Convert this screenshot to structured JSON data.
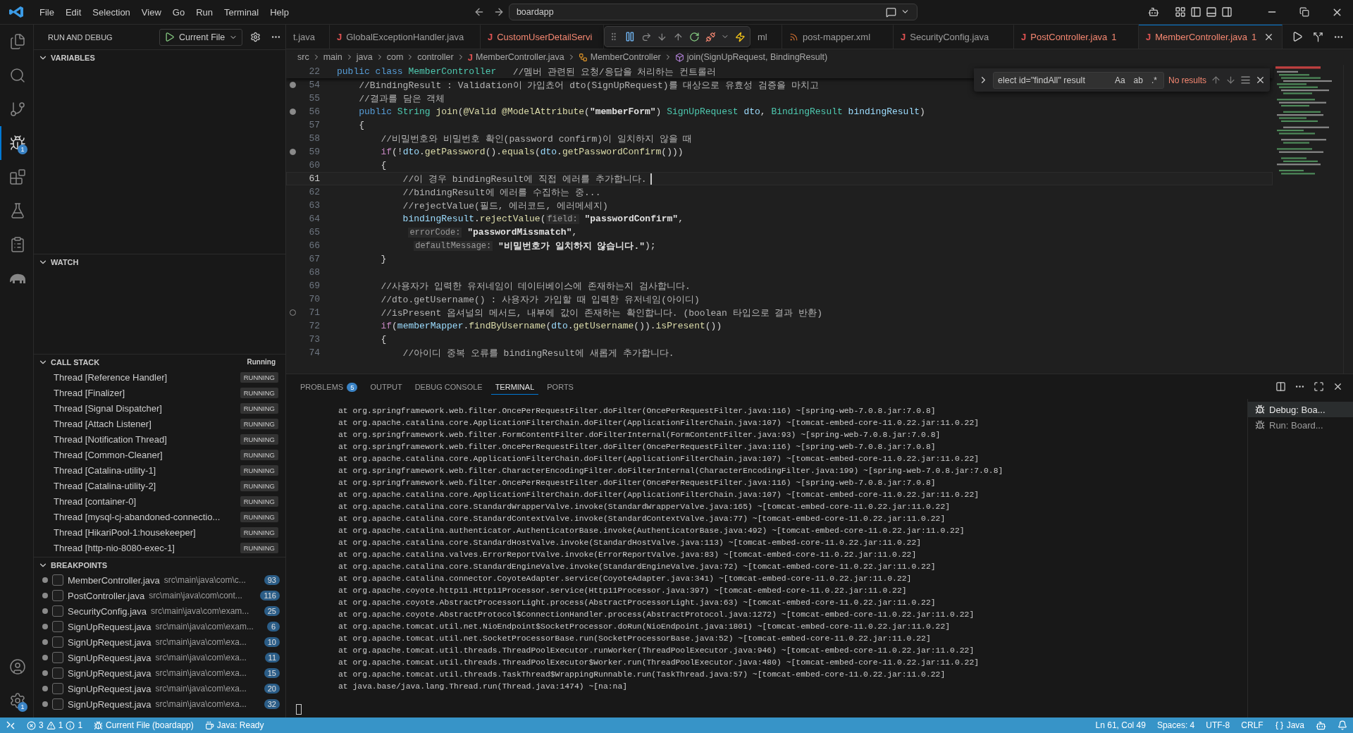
{
  "title_bar": {
    "menu": [
      "File",
      "Edit",
      "Selection",
      "View",
      "Go",
      "Run",
      "Terminal",
      "Help"
    ],
    "search": "boardapp"
  },
  "activity_bar": {
    "items": [
      {
        "kind": "files",
        "selected": false
      },
      {
        "kind": "search",
        "selected": false
      },
      {
        "kind": "source-control",
        "selected": false
      },
      {
        "kind": "debug",
        "selected": true,
        "badge": "1"
      },
      {
        "kind": "extensions",
        "selected": false
      },
      {
        "kind": "testing",
        "selected": false
      },
      {
        "kind": "clipboard",
        "selected": false
      },
      {
        "kind": "elephant",
        "selected": false
      }
    ],
    "bottom": [
      {
        "kind": "account"
      },
      {
        "kind": "settings",
        "badge": "1"
      }
    ]
  },
  "sidebar": {
    "title": "RUN AND DEBUG",
    "config": "Current File",
    "variables": {
      "title": "VARIABLES",
      "expanded": true
    },
    "watch": {
      "title": "WATCH",
      "expanded": true
    },
    "call_stack": {
      "title": "CALL STACK",
      "expanded": true,
      "status": "Running",
      "threads": [
        {
          "name": "Thread [Reference Handler]",
          "state": "RUNNING"
        },
        {
          "name": "Thread [Finalizer]",
          "state": "RUNNING"
        },
        {
          "name": "Thread [Signal Dispatcher]",
          "state": "RUNNING"
        },
        {
          "name": "Thread [Attach Listener]",
          "state": "RUNNING"
        },
        {
          "name": "Thread [Notification Thread]",
          "state": "RUNNING"
        },
        {
          "name": "Thread [Common-Cleaner]",
          "state": "RUNNING"
        },
        {
          "name": "Thread [Catalina-utility-1]",
          "state": "RUNNING"
        },
        {
          "name": "Thread [Catalina-utility-2]",
          "state": "RUNNING"
        },
        {
          "name": "Thread [container-0]",
          "state": "RUNNING"
        },
        {
          "name": "Thread [mysql-cj-abandoned-connectio...",
          "state": "RUNNING"
        },
        {
          "name": "Thread [HikariPool-1:housekeeper]",
          "state": "RUNNING"
        },
        {
          "name": "Thread [http-nio-8080-exec-1]",
          "state": "RUNNING"
        }
      ]
    },
    "breakpoints": {
      "title": "BREAKPOINTS",
      "expanded": true,
      "items": [
        {
          "file": "MemberController.java",
          "path": "src\\main\\java\\com\\c...",
          "line": "93",
          "checked": false
        },
        {
          "file": "PostController.java",
          "path": "src\\main\\java\\com\\cont...",
          "line": "116",
          "checked": false
        },
        {
          "file": "SecurityConfig.java",
          "path": "src\\main\\java\\com\\exam...",
          "line": "25",
          "checked": false
        },
        {
          "file": "SignUpRequest.java",
          "path": "src\\main\\java\\com\\exam...",
          "line": "6",
          "checked": false
        },
        {
          "file": "SignUpRequest.java",
          "path": "src\\main\\java\\com\\exa...",
          "line": "10",
          "checked": false
        },
        {
          "file": "SignUpRequest.java",
          "path": "src\\main\\java\\com\\exa...",
          "line": "11",
          "checked": false
        },
        {
          "file": "SignUpRequest.java",
          "path": "src\\main\\java\\com\\exa...",
          "line": "15",
          "checked": false
        },
        {
          "file": "SignUpRequest.java",
          "path": "src\\main\\java\\com\\exa...",
          "line": "20",
          "checked": false
        },
        {
          "file": "SignUpRequest.java",
          "path": "src\\main\\java\\com\\exa...",
          "line": "32",
          "checked": false
        }
      ]
    }
  },
  "editor": {
    "tabs": [
      {
        "label": "t.java",
        "kind": "none",
        "error": false,
        "selected": false
      },
      {
        "label": "GlobalExceptionHandler.java",
        "kind": "java",
        "icon": "J",
        "error": false,
        "selected": false
      },
      {
        "label": "CustomUserDetailServi",
        "kind": "java",
        "icon": "J",
        "error": true,
        "selected": false
      },
      {
        "label": "ml",
        "kind": "none",
        "error": false,
        "selected": false
      },
      {
        "label": "post-mapper.xml",
        "kind": "xml",
        "error": false,
        "selected": false
      },
      {
        "label": "SecurityConfig.java",
        "kind": "java",
        "icon": "J",
        "error": false,
        "selected": false
      },
      {
        "label": "PostController.java",
        "kind": "java",
        "icon": "J",
        "error": true,
        "count": "1",
        "selected": false
      },
      {
        "label": "MemberController.java",
        "kind": "java",
        "icon": "J",
        "error": true,
        "count": "1",
        "selected": true
      }
    ],
    "breadcrumb": [
      {
        "text": "src",
        "kind": "folder"
      },
      {
        "text": "main",
        "kind": "folder"
      },
      {
        "text": "java",
        "kind": "folder"
      },
      {
        "text": "com",
        "kind": "folder"
      },
      {
        "text": "controller",
        "kind": "folder"
      },
      {
        "text": "MemberController.java",
        "kind": "java",
        "icon": "J"
      },
      {
        "text": "MemberController",
        "kind": "class"
      },
      {
        "text": "join(SignUpRequest, BindingResult)",
        "kind": "method"
      }
    ],
    "sticky": {
      "number": "22",
      "tokens": [
        {
          "t": "public class ",
          "kind": "kw"
        },
        {
          "t": "MemberController",
          "kind": "type"
        },
        {
          "t": "   //멤버 관련된 요청/응답을 처리하는 컨트롤러",
          "kind": "cmt"
        }
      ]
    },
    "lines": [
      {
        "number": "54",
        "kind": "breakpoint",
        "current": false,
        "tokens": [
          {
            "t": "    //BindingResult : Validation이 가입쵸어 dto(SignUpRequest)를 대상으로 유효성 검증을 마치고",
            "kind": "cmt"
          }
        ]
      },
      {
        "number": "55",
        "kind": "plain",
        "current": false,
        "tokens": [
          {
            "t": "    //결과를 담은 객체",
            "kind": "cmt"
          }
        ]
      },
      {
        "number": "56",
        "kind": "breakpoint",
        "current": false,
        "tokens": [
          {
            "t": "    public ",
            "kind": "kw"
          },
          {
            "t": "String ",
            "kind": "type"
          },
          {
            "t": "join",
            "kind": "fn"
          },
          {
            "t": "(",
            "kind": "p"
          },
          {
            "t": "@Valid @ModelAttribute",
            "kind": "fn"
          },
          {
            "t": "(",
            "kind": "p"
          },
          {
            "t": "\"memberForm\"",
            "kind": "str"
          },
          {
            "t": ") ",
            "kind": "p"
          },
          {
            "t": "SignUpRequest ",
            "kind": "type"
          },
          {
            "t": "dto",
            "kind": "var"
          },
          {
            "t": ", ",
            "kind": "p"
          },
          {
            "t": "BindingResult ",
            "kind": "type"
          },
          {
            "t": "bindingResult",
            "kind": "var"
          },
          {
            "t": ")",
            "kind": "p"
          }
        ]
      },
      {
        "number": "57",
        "kind": "plain",
        "current": false,
        "tokens": [
          {
            "t": "    {",
            "kind": "p"
          }
        ]
      },
      {
        "number": "58",
        "kind": "plain",
        "current": false,
        "tokens": [
          {
            "t": "        //비밀번호와 비밀번호 확인(password confirm)이 일치하지 않을 때",
            "kind": "cmt"
          }
        ]
      },
      {
        "number": "59",
        "kind": "breakpoint",
        "current": false,
        "tokens": [
          {
            "t": "        if",
            "kind": "ctl"
          },
          {
            "t": "(!",
            "kind": "p"
          },
          {
            "t": "dto",
            "kind": "var"
          },
          {
            "t": ".",
            "kind": "p"
          },
          {
            "t": "getPassword",
            "kind": "fn"
          },
          {
            "t": "().",
            "kind": "p"
          },
          {
            "t": "equals",
            "kind": "fn"
          },
          {
            "t": "(",
            "kind": "p"
          },
          {
            "t": "dto",
            "kind": "var"
          },
          {
            "t": ".",
            "kind": "p"
          },
          {
            "t": "getPasswordConfirm",
            "kind": "fn"
          },
          {
            "t": "()))",
            "kind": "p"
          }
        ]
      },
      {
        "number": "60",
        "kind": "plain",
        "current": false,
        "tokens": [
          {
            "t": "        {",
            "kind": "p"
          }
        ]
      },
      {
        "number": "61",
        "kind": "plain",
        "current": true,
        "tokens": [
          {
            "t": "            //이 경우 bindingResult에 직접 에러를 추가합니다.",
            "kind": "cmt"
          }
        ]
      },
      {
        "number": "62",
        "kind": "plain",
        "current": false,
        "tokens": [
          {
            "t": "            //bindingResult에 에러를 수집하는 중...",
            "kind": "cmt"
          }
        ]
      },
      {
        "number": "63",
        "kind": "plain",
        "current": false,
        "tokens": [
          {
            "t": "            //rejectValue(필드, 에러코드, 에러메세지)",
            "kind": "cmt"
          }
        ]
      },
      {
        "number": "64",
        "kind": "plain",
        "current": false,
        "tokens": [
          {
            "t": "            bindingResult",
            "kind": "var"
          },
          {
            "t": ".",
            "kind": "p"
          },
          {
            "t": "rejectValue",
            "kind": "fn"
          },
          {
            "t": "(",
            "kind": "p"
          },
          {
            "t": "field:",
            "kind": "hint"
          },
          {
            "t": " \"passwordConfirm\"",
            "kind": "str"
          },
          {
            "t": ",",
            "kind": "p"
          }
        ]
      },
      {
        "number": "65",
        "kind": "plain",
        "current": false,
        "tokens": [
          {
            "t": "             errorCode:",
            "kind": "hint"
          },
          {
            "t": " \"passwordMissmatch\"",
            "kind": "str"
          },
          {
            "t": ",",
            "kind": "p"
          }
        ]
      },
      {
        "number": "66",
        "kind": "plain",
        "current": false,
        "tokens": [
          {
            "t": "              defaultMessage:",
            "kind": "hint"
          },
          {
            "t": " \"비밀번호가 일치하지 않습니다.\"",
            "kind": "str"
          },
          {
            "t": ");",
            "kind": "p"
          }
        ]
      },
      {
        "number": "67",
        "kind": "plain",
        "current": false,
        "tokens": [
          {
            "t": "        }",
            "kind": "p"
          }
        ]
      },
      {
        "number": "68",
        "kind": "plain",
        "current": false
      },
      {
        "number": "69",
        "kind": "plain",
        "current": false,
        "tokens": [
          {
            "t": "        //사용자가 입력한 유저네임이 데이터베이스에 존재하는지 검사합니다.",
            "kind": "cmt"
          }
        ]
      },
      {
        "number": "70",
        "kind": "plain",
        "current": false,
        "tokens": [
          {
            "t": "        //dto.getUsername() : 사용자가 가입할 때 입력한 유저네임(아이디)",
            "kind": "cmt"
          }
        ]
      },
      {
        "number": "71",
        "kind": "unverified",
        "current": false,
        "tokens": [
          {
            "t": "        //isPresent 옵셔널의 메서드, 내부에 값이 존재하는 확인합니다. (boolean 타입으로 결과 반환)",
            "kind": "cmt"
          }
        ]
      },
      {
        "number": "72",
        "kind": "plain",
        "current": false,
        "tokens": [
          {
            "t": "        if",
            "kind": "ctl"
          },
          {
            "t": "(",
            "kind": "p"
          },
          {
            "t": "memberMapper",
            "kind": "var"
          },
          {
            "t": ".",
            "kind": "p"
          },
          {
            "t": "findByUsername",
            "kind": "fn"
          },
          {
            "t": "(",
            "kind": "p"
          },
          {
            "t": "dto",
            "kind": "var"
          },
          {
            "t": ".",
            "kind": "p"
          },
          {
            "t": "getUsername",
            "kind": "fn"
          },
          {
            "t": "()).",
            "kind": "p"
          },
          {
            "t": "isPresent",
            "kind": "fn"
          },
          {
            "t": "())",
            "kind": "p"
          }
        ]
      },
      {
        "number": "73",
        "kind": "plain",
        "current": false,
        "tokens": [
          {
            "t": "        {",
            "kind": "p"
          }
        ]
      },
      {
        "number": "74",
        "kind": "plain",
        "current": false,
        "tokens": [
          {
            "t": "            //아이디 중복 오류를 bindingResult에 새롭게 추가합니다.",
            "kind": "cmt"
          }
        ]
      }
    ],
    "find": {
      "value": "elect id=\"findAll\" result",
      "options": [
        {
          "label": "Aa",
          "on": false
        },
        {
          "label": "ab",
          "on": false
        },
        {
          "label": ".*",
          "on": false
        }
      ],
      "result": "No results"
    }
  },
  "panel": {
    "tabs": [
      {
        "label": "PROBLEMS",
        "badge": "5",
        "selected": false
      },
      {
        "label": "OUTPUT",
        "selected": false
      },
      {
        "label": "DEBUG CONSOLE",
        "selected": false
      },
      {
        "label": "TERMINAL",
        "selected": true
      },
      {
        "label": "PORTS",
        "selected": false
      }
    ],
    "terminal_lines": [
      "at org.springframework.web.filter.OncePerRequestFilter.doFilter(OncePerRequestFilter.java:116) ~[spring-web-7.0.8.jar:7.0.8]",
      "at org.apache.catalina.core.ApplicationFilterChain.doFilter(ApplicationFilterChain.java:107) ~[tomcat-embed-core-11.0.22.jar:11.0.22]",
      "at org.springframework.web.filter.FormContentFilter.doFilterInternal(FormContentFilter.java:93) ~[spring-web-7.0.8.jar:7.0.8]",
      "at org.springframework.web.filter.OncePerRequestFilter.doFilter(OncePerRequestFilter.java:116) ~[spring-web-7.0.8.jar:7.0.8]",
      "at org.apache.catalina.core.ApplicationFilterChain.doFilter(ApplicationFilterChain.java:107) ~[tomcat-embed-core-11.0.22.jar:11.0.22]",
      "at org.springframework.web.filter.CharacterEncodingFilter.doFilterInternal(CharacterEncodingFilter.java:199) ~[spring-web-7.0.8.jar:7.0.8]",
      "at org.springframework.web.filter.OncePerRequestFilter.doFilter(OncePerRequestFilter.java:116) ~[spring-web-7.0.8.jar:7.0.8]",
      "at org.apache.catalina.core.ApplicationFilterChain.doFilter(ApplicationFilterChain.java:107) ~[tomcat-embed-core-11.0.22.jar:11.0.22]",
      "at org.apache.catalina.core.StandardWrapperValve.invoke(StandardWrapperValve.java:165) ~[tomcat-embed-core-11.0.22.jar:11.0.22]",
      "at org.apache.catalina.core.StandardContextValve.invoke(StandardContextValve.java:77) ~[tomcat-embed-core-11.0.22.jar:11.0.22]",
      "at org.apache.catalina.authenticator.AuthenticatorBase.invoke(AuthenticatorBase.java:492) ~[tomcat-embed-core-11.0.22.jar:11.0.22]",
      "at org.apache.catalina.core.StandardHostValve.invoke(StandardHostValve.java:113) ~[tomcat-embed-core-11.0.22.jar:11.0.22]",
      "at org.apache.catalina.valves.ErrorReportValve.invoke(ErrorReportValve.java:83) ~[tomcat-embed-core-11.0.22.jar:11.0.22]",
      "at org.apache.catalina.core.StandardEngineValve.invoke(StandardEngineValve.java:72) ~[tomcat-embed-core-11.0.22.jar:11.0.22]",
      "at org.apache.catalina.connector.CoyoteAdapter.service(CoyoteAdapter.java:341) ~[tomcat-embed-core-11.0.22.jar:11.0.22]",
      "at org.apache.coyote.http11.Http11Processor.service(Http11Processor.java:397) ~[tomcat-embed-core-11.0.22.jar:11.0.22]",
      "at org.apache.coyote.AbstractProcessorLight.process(AbstractProcessorLight.java:63) ~[tomcat-embed-core-11.0.22.jar:11.0.22]",
      "at org.apache.coyote.AbstractProtocol$ConnectionHandler.process(AbstractProtocol.java:1272) ~[tomcat-embed-core-11.0.22.jar:11.0.22]",
      "at org.apache.tomcat.util.net.NioEndpoint$SocketProcessor.doRun(NioEndpoint.java:1801) ~[tomcat-embed-core-11.0.22.jar:11.0.22]",
      "at org.apache.tomcat.util.net.SocketProcessorBase.run(SocketProcessorBase.java:52) ~[tomcat-embed-core-11.0.22.jar:11.0.22]",
      "at org.apache.tomcat.util.threads.ThreadPoolExecutor.runWorker(ThreadPoolExecutor.java:946) ~[tomcat-embed-core-11.0.22.jar:11.0.22]",
      "at org.apache.tomcat.util.threads.ThreadPoolExecutor$Worker.run(ThreadPoolExecutor.java:480) ~[tomcat-embed-core-11.0.22.jar:11.0.22]",
      "at org.apache.tomcat.util.threads.TaskThread$WrappingRunnable.run(TaskThread.java:57) ~[tomcat-embed-core-11.0.22.jar:11.0.22]",
      "at java.base/java.lang.Thread.run(Thread.java:1474) ~[na:na]"
    ],
    "terminals": [
      {
        "label": "Debug: Boa...",
        "selected": true
      },
      {
        "label": "Run: Board...",
        "selected": false
      }
    ]
  },
  "status_bar": {
    "errors": "3",
    "warnings": "1",
    "infos": "1",
    "debug": "Current File (boardapp)",
    "java": "Java: Ready",
    "right": [
      {
        "text": "Ln 61, Col 49",
        "kind": "text"
      },
      {
        "text": "Spaces: 4",
        "kind": "text"
      },
      {
        "text": "UTF-8",
        "kind": "text"
      },
      {
        "text": "CRLF",
        "kind": "text"
      },
      {
        "text": "Java",
        "kind": "language"
      }
    ]
  }
}
